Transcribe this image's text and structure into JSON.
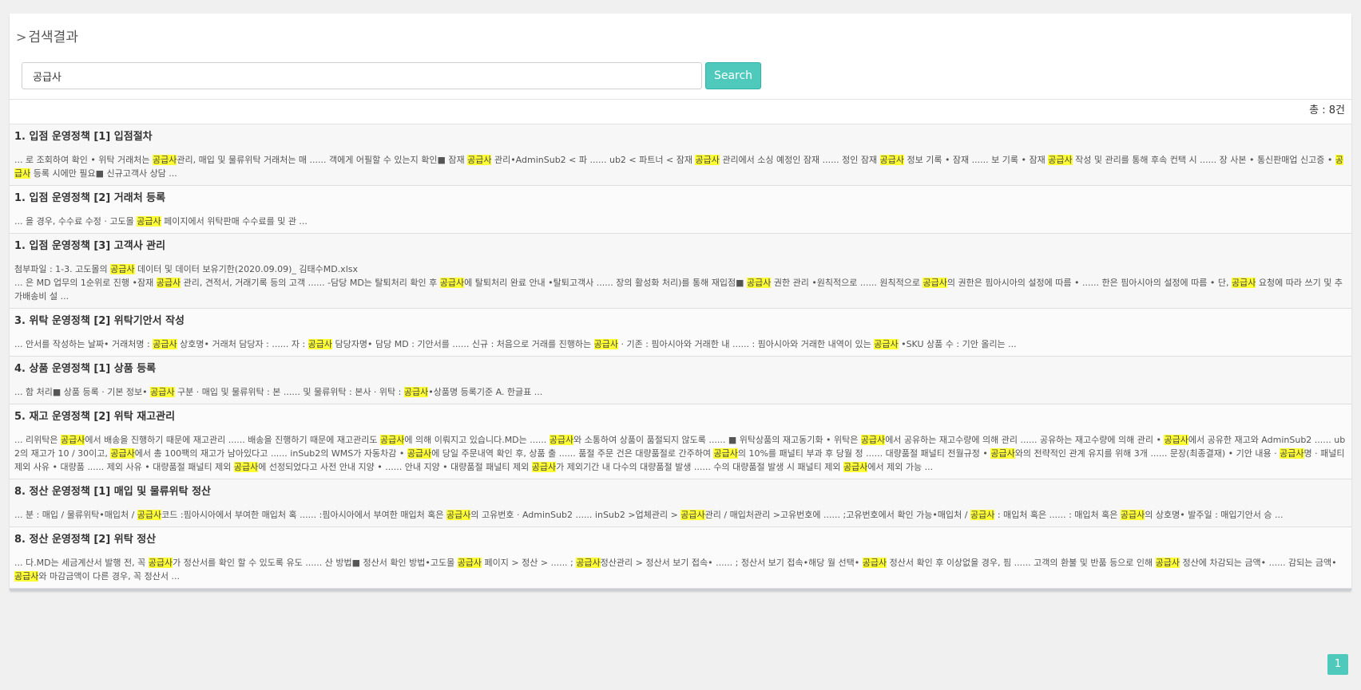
{
  "header": {
    "chevron": ">",
    "title": "검색결과"
  },
  "search": {
    "query": "공급사",
    "button_label": "Search"
  },
  "count_label": "총 : 8건",
  "highlight_term": "공급사",
  "results": [
    {
      "title": "1. 입점 운영정책 [1] 입점절차",
      "lines": [
        "... 로 조회하여 확인 • 위탁 거래처는 공급사관리, 매입 및 물류위탁 거래처는 매 ...... 객에게 어필할 수 있는지 확인■ 잠재 공급사 관리•AdminSub2 < 파 ...... ub2 < 파트너 < 잠재 공급사 관리에서 소싱 예정인 잠재 ...... 정인 잠재 공급사 정보 기록 • 잠재 ...... 보 기록 • 잠재 공급사 작성 및 관리를 통해 후속 컨택 시 ...... 장 사본 • 통신판매업 신고증 • 공급사 등록 시에만 필요■ 신규고객사 상담 ..."
      ]
    },
    {
      "title": "1. 입점 운영정책 [2] 거래처 등록",
      "lines": [
        "... 을 경우, 수수료 수정 · 고도몰 공급사 페이지에서 위탁판매 수수료를 및 관 ..."
      ]
    },
    {
      "title": "1. 입점 운영정책 [3] 고객사 관리",
      "lines": [
        "첨부파일 : 1-3. 고도몰의 공급사 데이터 및 데이터 보유기한(2020.09.09)_ 김태수MD.xlsx",
        "... 은 MD 업무의 1순위로 진행 •잠재 공급사 관리, 견적서, 거래기록 등의 고객 ...... -담당 MD는 탈퇴처리 확인 후 공급사에 탈퇴처리 완료 안내 •탈퇴고객사 ...... 장의 활성화 처리)를 통해 재입점■ 공급사 권한 관리 •원칙적으로 ...... 원칙적으로 공급사의 권한은 핌아시아의 설정에 따름 • ...... 한은 핌아시아의 설정에 따름 • 단, 공급사 요청에 따라 쓰기 및 추가배송비 설 ..."
      ]
    },
    {
      "title": "3. 위탁 운영정책 [2] 위탁기안서 작성",
      "lines": [
        "... 안서를 작성하는 날짜• 거래처명 : 공급사 상호명• 거래처 담당자 : ...... 자 : 공급사 담당자명• 담당 MD : 기안서를 ...... 신규 : 처음으로 거래를 진행하는 공급사 · 기존 : 핌아시아와 거래한 내 ...... : 핌아시아와 거래한 내역이 있는 공급사 •SKU 상품 수 : 기안 올리는 ..."
      ]
    },
    {
      "title": "4. 상품 운영정책 [1] 상품 등록",
      "lines": [
        "... 함 처리■ 상품 등록 · 기본 정보• 공급사 구분 · 매입 및 물류위탁 : 본 ...... 및 물류위탁 : 본사 · 위탁 : 공급사•상품명 등록기준 A. 한글표 ..."
      ]
    },
    {
      "title": "5. 재고 운영정책 [2] 위탁 재고관리",
      "lines": [
        "... 리위탁은 공급사에서 배송을 진행하기 때문에 재고관리 ...... 배송을 진행하기 때문에 재고관리도 공급사에 의해 이뤄지고 있습니다.MD는 ...... 공급사와 소통하여 상품이 품절되지 않도록 ...... ■ 위탁상품의 재고동기화 • 위탁은 공급사에서 공유하는 재고수량에 의해 관리 ...... 공유하는 재고수량에 의해 관리 • 공급사에서 공유한 재고와 AdminSub2 ...... ub2의 재고가 10 / 30이고, 공급사에서 총 100팩의 재고가 남아있다고 ...... inSub2의 WMS가 자동차감 • 공급사에 당일 주문내역 확인 후, 상품 출 ...... 품절 주문 건은 대량품절로 간주하여 공급사의 10%를 패널티 부과 후 당월 정 ...... 대량품절 패널티 전월규정 • 공급사와의 전략적인 관계 유지를 위해 3개 ...... 문장(최종결재) • 기안 내용 · 공급사명 · 패널티 제외 사유 • 대량품 ...... 제외 사유 • 대량품절 패널티 제외 공급사에 선정되었다고 사전 안내 지양 • ...... 안내 지양 • 대량품절 패널티 제외 공급사가 제외기간 내 다수의 대량품절 발생 ...... 수의 대량품절 발생 시 패널티 제외 공급사에서 제외 가능 ..."
      ]
    },
    {
      "title": "8. 정산 운영정책 [1] 매입 및 물류위탁 정산",
      "lines": [
        "... 분 : 매입 / 물류위탁•매입처 / 공급사코드 :핌아시아에서 부여한 매입처 혹 ...... :핌아시아에서 부여한 매입처 혹은 공급사의 고유번호 · AdminSub2 ...... inSub2 >업체관리 > 공급사관리 / 매입처관리 >고유번호에 ...... ;고유번호에서 확인 가능•매입처 / 공급사 : 매입처 혹은 ...... : 매입처 혹은 공급사의 상호명• 발주일 : 매입기안서 승 ..."
      ]
    },
    {
      "title": "8. 정산 운영정책 [2] 위탁 정산",
      "lines": [
        "... 다.MD는 세금계산서 발행 전, 꼭 공급사가 정산서를 확인 할 수 있도록 유도 ...... 산 방법■ 정산서 확인 방법•고도몰 공급사 페이지 > 정산 > ...... ; 공급사정산관리 > 정산서 보기 접속• ...... ; 정산서 보기 접속•해당 월 선택• 공급사 정산서 확인 후 이상없을 경우, 핌 ...... 고객의 환불 및 반품 등으로 인해 공급사 정산에 차감되는 금액• ...... 감되는 금액• 공급사와 마감금액이 다른 경우, 꼭 정산서 ..."
      ]
    }
  ],
  "pagination": {
    "current_page": "1"
  }
}
